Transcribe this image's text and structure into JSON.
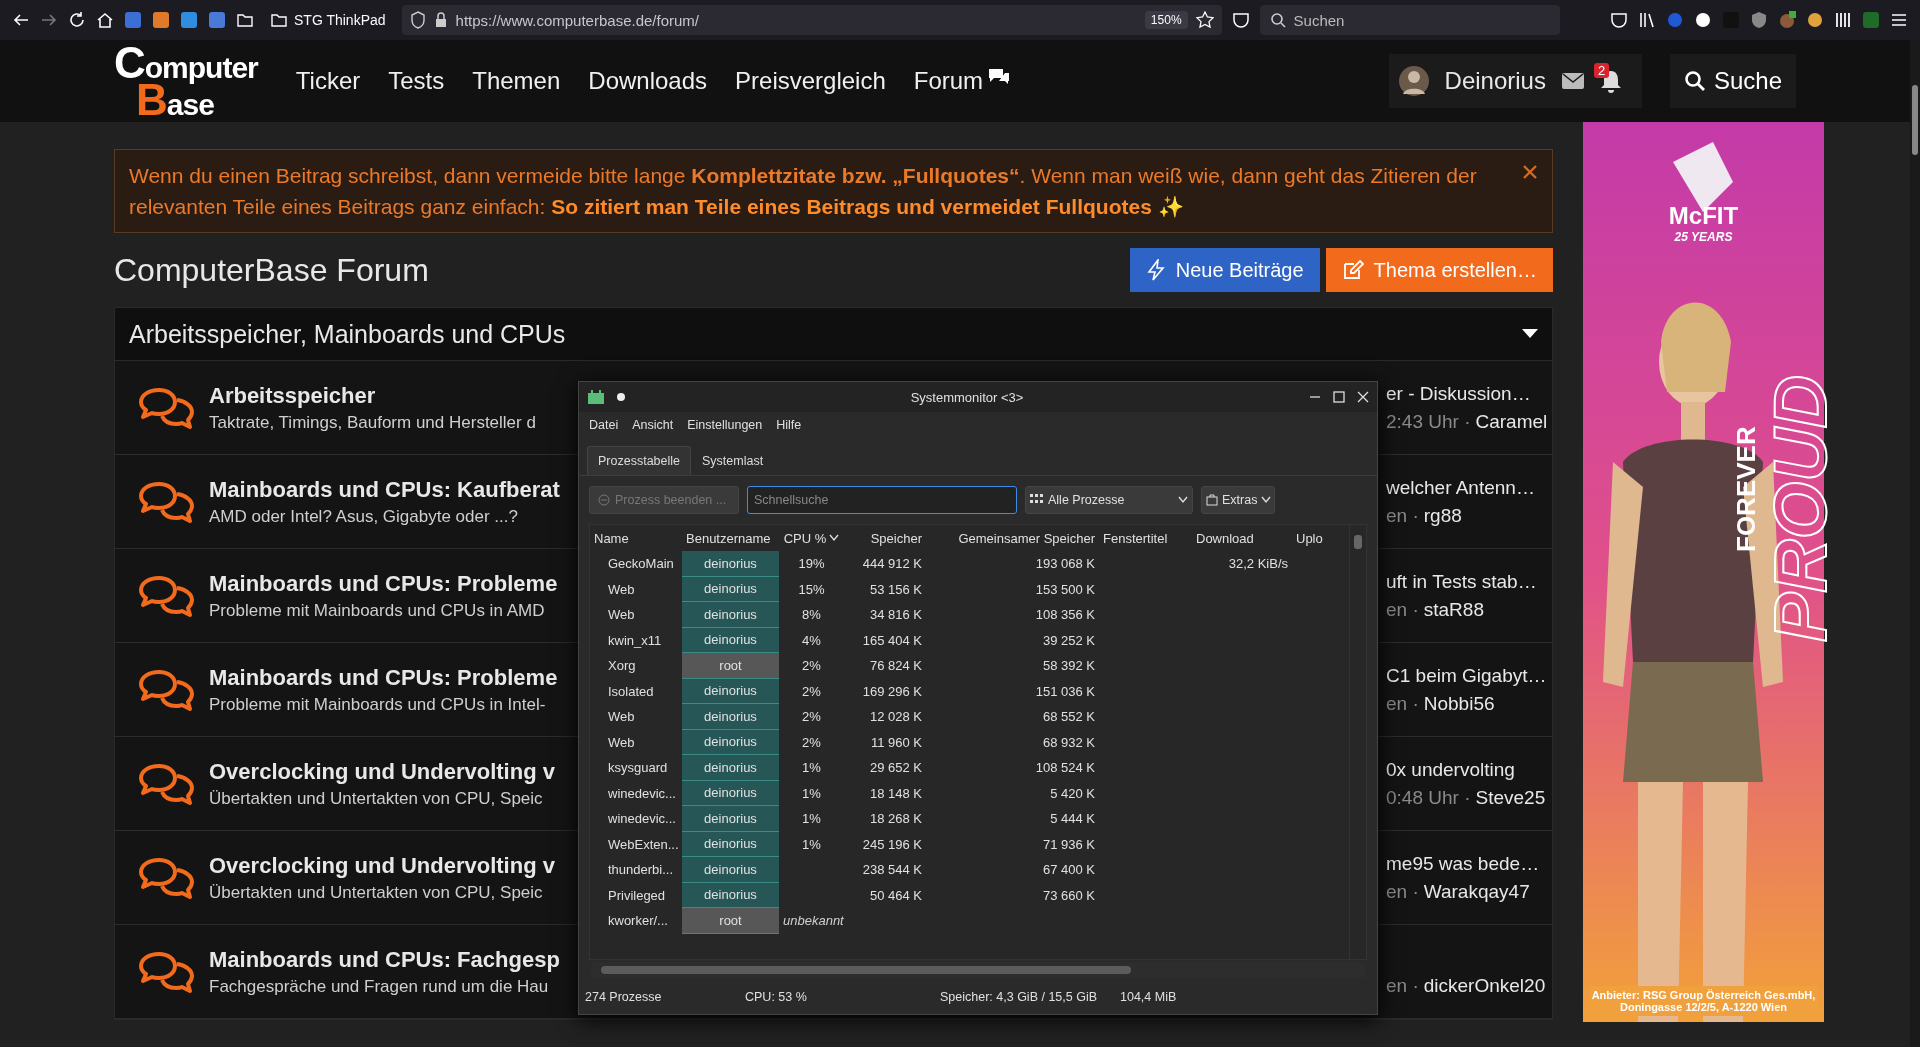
{
  "browser": {
    "bookmark": "STG ThinkPad",
    "url": "https://www.computerbase.de/forum/",
    "zoom": "150%",
    "search_placeholder": "Suchen"
  },
  "site_nav": {
    "logo": [
      "Computer",
      "Base"
    ],
    "links": [
      "Ticker",
      "Tests",
      "Themen",
      "Downloads",
      "Preisvergleich",
      "Forum"
    ],
    "user": "Deinorius",
    "notification_count": "2",
    "search_button": "Suche"
  },
  "notice": {
    "text": "Wenn du einen Beitrag schreibst, dann vermeide bitte lange **Komplettzitate bzw. „Fullquotes“**. Wenn man weiß wie, dann geht das Zitieren der relevanten Teile eines Beitrags ganz einfach:",
    "link": "So zitiert man Teile eines Beitrags und vermeidet Fullquotes ✨"
  },
  "forum": {
    "title": "ComputerBase Forum",
    "buttons": [
      {
        "label": "Neue Beiträge",
        "kind": "primary"
      },
      {
        "label": "Thema erstellen…",
        "kind": "accent"
      }
    ],
    "category": {
      "title": "Arbeitsspeicher, Mainboards und CPUs",
      "expanded": true
    },
    "rows": [
      {
        "title": "Arbeitsspeicher",
        "description": "Taktrate, Timings, Bauform und Hersteller d",
        "last_title": "er - Diskussion…",
        "last_time": "2:43 Uhr ·",
        "last_user": "Caramel"
      },
      {
        "title": "Mainboards und CPUs: Kaufberat",
        "description": "AMD oder Intel? Asus, Gigabyte oder ...?",
        "last_title": "welcher Antenn…",
        "last_time": "en ·",
        "last_user": "rg88"
      },
      {
        "title": "Mainboards und CPUs: Probleme",
        "description": "Probleme mit Mainboards und CPUs in AMD",
        "last_title": "uft in Tests stab…",
        "last_time": "en ·",
        "last_user": "staR88"
      },
      {
        "title": "Mainboards und CPUs: Probleme",
        "description": "Probleme mit Mainboards und CPUs in Intel-",
        "last_title": "C1 beim Gigabyt…",
        "last_time": "en ·",
        "last_user": "Nobbi56"
      },
      {
        "title": "Overclocking und Undervolting v",
        "description": "Übertakten und Untertakten von CPU, Speic",
        "last_title": "0x undervolting",
        "last_time": "0:48 Uhr ·",
        "last_user": "Steve25"
      },
      {
        "title": "Overclocking und Undervolting v",
        "description": "Übertakten und Untertakten von CPU, Speic",
        "last_title": "me95 was bede…",
        "last_time": "en ·",
        "last_user": "Warakqay47"
      },
      {
        "title": "Mainboards und CPUs: Fachgesp",
        "description": "Fachgespräche und Fragen rund um die Hau",
        "last_time": "en ·",
        "last_user": "dickerOnkel20"
      }
    ]
  },
  "system_monitor": {
    "title": "Systemmonitor <3>",
    "menu": [
      "Datei",
      "Ansicht",
      "Einstellungen",
      "Hilfe"
    ],
    "tabs": [
      {
        "label": "Prozesstabelle",
        "selected": true
      },
      {
        "label": "Systemlast",
        "selected": false
      }
    ],
    "end_button": {
      "label": "Prozess beenden ...",
      "disabled": true
    },
    "search": {
      "placeholder": "Schnellsuche"
    },
    "filter": "Alle Prozesse",
    "extras": "Extras",
    "columns": [
      {
        "label": "Name",
        "sorted": false
      },
      {
        "label": "Benutzername",
        "sorted": false
      },
      {
        "label": "CPU %",
        "sorted": true
      },
      {
        "label": "Speicher",
        "sorted": false
      },
      {
        "label": "Gemeinsamer Speicher",
        "sorted": false
      },
      {
        "label": "Fenstertitel",
        "sorted": false
      },
      {
        "label": "Download",
        "sorted": false
      },
      {
        "label": "Uplo",
        "sorted": false
      }
    ],
    "rows": [
      {
        "name": "GeckoMain",
        "user": "deinorius",
        "color": "#265656",
        "cpu": "19%",
        "cpu_known": true,
        "memory": "444 912 K",
        "shared": "193 068 K",
        "download": "32,2 KiB/s"
      },
      {
        "name": "Web",
        "user": "deinorius",
        "color": "#265656",
        "cpu": "15%",
        "cpu_known": true,
        "memory": "53 156 K",
        "shared": "153 500 K"
      },
      {
        "name": "Web",
        "user": "deinorius",
        "color": "#265656",
        "cpu": "8%",
        "cpu_known": true,
        "memory": "34 816 K",
        "shared": "108 356 K"
      },
      {
        "name": "kwin_x11",
        "user": "deinorius",
        "color": "#265656",
        "cpu": "4%",
        "cpu_known": true,
        "memory": "165 404 K",
        "shared": "39 252 K"
      },
      {
        "name": "Xorg",
        "user": "root",
        "color": "#575757",
        "cpu": "2%",
        "cpu_known": true,
        "memory": "76 824 K",
        "shared": "58 392 K"
      },
      {
        "name": "Isolated",
        "user": "deinorius",
        "color": "#265656",
        "cpu": "2%",
        "cpu_known": true,
        "memory": "169 296 K",
        "shared": "151 036 K"
      },
      {
        "name": "Web",
        "user": "deinorius",
        "color": "#265656",
        "cpu": "2%",
        "cpu_known": true,
        "memory": "12 028 K",
        "shared": "68 552 K"
      },
      {
        "name": "Web",
        "user": "deinorius",
        "color": "#265656",
        "cpu": "2%",
        "cpu_known": true,
        "memory": "11 960 K",
        "shared": "68 932 K"
      },
      {
        "name": "ksysguard",
        "user": "deinorius",
        "color": "#265656",
        "cpu": "1%",
        "cpu_known": true,
        "memory": "29 652 K",
        "shared": "108 524 K"
      },
      {
        "name": "winedevic...",
        "user": "deinorius",
        "color": "#265656",
        "cpu": "1%",
        "cpu_known": true,
        "memory": "18 148 K",
        "shared": "5 420 K"
      },
      {
        "name": "winedevic...",
        "user": "deinorius",
        "color": "#265656",
        "cpu": "1%",
        "cpu_known": true,
        "memory": "18 268 K",
        "shared": "5 444 K"
      },
      {
        "name": "WebExten...",
        "user": "deinorius",
        "color": "#265656",
        "cpu": "1%",
        "cpu_known": true,
        "memory": "245 196 K",
        "shared": "71 936 K"
      },
      {
        "name": "thunderbi...",
        "user": "deinorius",
        "color": "#265656",
        "memory": "238 544 K",
        "shared": "67 400 K"
      },
      {
        "name": "Privileged",
        "user": "deinorius",
        "color": "#265656",
        "memory": "50 464 K",
        "shared": "73 660 K"
      },
      {
        "name": "kworker/...",
        "user": "root",
        "color": "#575757",
        "cpu": "unbekannt",
        "cpu_known": false
      }
    ],
    "status": [
      "274 Prozesse",
      "CPU: 53 %",
      "Speicher: 4,3 GiB / 15,5 GiB",
      "104,4 MiB"
    ]
  },
  "ad": {
    "kind": "picture",
    "brand": "McFIT",
    "tagline": "25 YEARS",
    "slogan": [
      "FOREVER",
      "PROUD"
    ],
    "imprint": "Anbieter: RSG Group Österreich Ges.mbH, Doningasse 12/2/5, A-1220 Wien"
  }
}
